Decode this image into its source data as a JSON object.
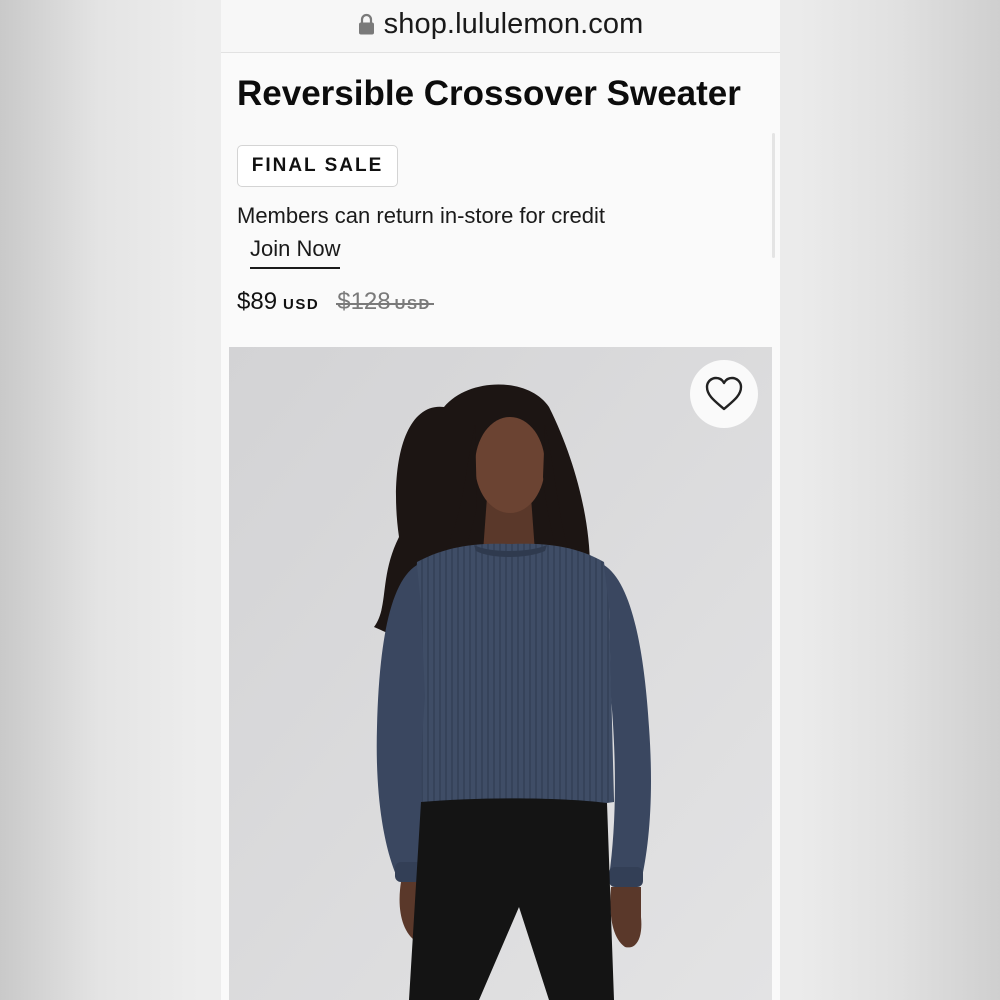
{
  "browser": {
    "url": "shop.lululemon.com"
  },
  "product": {
    "title": "Reversible Crossover Sweater",
    "badge": "FINAL SALE",
    "membership_note": "Members can return in-store for credit",
    "join_label": "Join Now",
    "price": {
      "current": "$89",
      "currency": "USD",
      "original": "$128",
      "original_currency": "USD"
    },
    "image": {
      "subject": "Model wearing navy ribbed crew-neck sweater and black leggings"
    }
  },
  "icons": {
    "lock": "lock-icon",
    "favorite": "heart-outline-icon"
  },
  "colors": {
    "sweater": "#3f4d66",
    "background": "#fafafa",
    "photo_backdrop": "#dadadb",
    "strike": "#7a7a7a"
  }
}
